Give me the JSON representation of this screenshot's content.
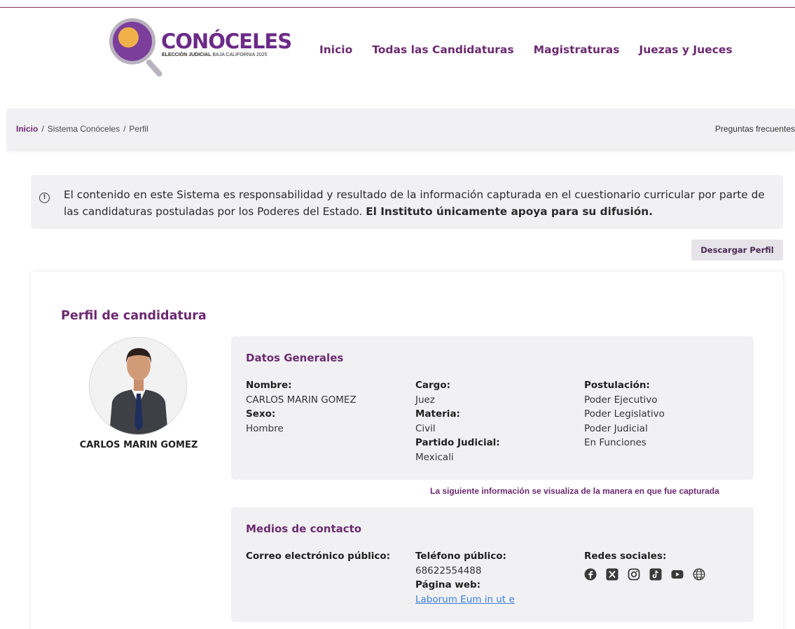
{
  "header": {
    "logo_title": "CONÓCELES",
    "logo_subtitle_bold": "ELECCIÓN JUDICIAL",
    "logo_subtitle": " BAJA CALIFORNIA 2025",
    "nav": [
      "Inicio",
      "Todas las Candidaturas",
      "Magistraturas",
      "Juezas y Jueces"
    ]
  },
  "breadcrumb": {
    "home": "Inicio",
    "items": [
      "Sistema Conóceles",
      "Perfil"
    ],
    "separator": "/",
    "faq": "Preguntas frecuentes"
  },
  "notice": {
    "text": "El contenido en este Sistema es responsabilidad y resultado de la información capturada en el cuestionario curricular por parte de las candidaturas postuladas por los Poderes del Estado. ",
    "bold": "El Instituto únicamente apoya para su difusión."
  },
  "download_button": "Descargar Perfil",
  "profile": {
    "title": "Perfil de candidatura",
    "name": "CARLOS MARIN GOMEZ",
    "general": {
      "title": "Datos Generales",
      "nombre_label": "Nombre:",
      "nombre": "CARLOS MARIN GOMEZ",
      "sexo_label": "Sexo:",
      "sexo": "Hombre",
      "cargo_label": "Cargo:",
      "cargo": "Juez",
      "materia_label": "Materia:",
      "materia": "Civil",
      "partido_label": "Partido Judicial:",
      "partido": "Mexicali",
      "postulacion_label": "Postulación:",
      "postulacion": [
        "Poder Ejecutivo",
        "Poder Legislativo",
        "Poder Judicial",
        "En Funciones"
      ]
    },
    "capture_note": "La siguiente información se visualiza de la manera en que fue capturada",
    "contact": {
      "title": "Medios de contacto",
      "email_label": "Correo electrónico público:",
      "phone_label": "Teléfono público:",
      "phone": "68622554488",
      "web_label": "Página web:",
      "web": "Laborum Eum in ut e",
      "social_label": "Redes sociales:",
      "social_icons": [
        "facebook-icon",
        "x-icon",
        "instagram-icon",
        "tiktok-icon",
        "youtube-icon",
        "globe-icon"
      ]
    }
  },
  "colors": {
    "accent": "#6b2a70",
    "panel": "#f1f1f3",
    "link": "#3c7cd8"
  }
}
